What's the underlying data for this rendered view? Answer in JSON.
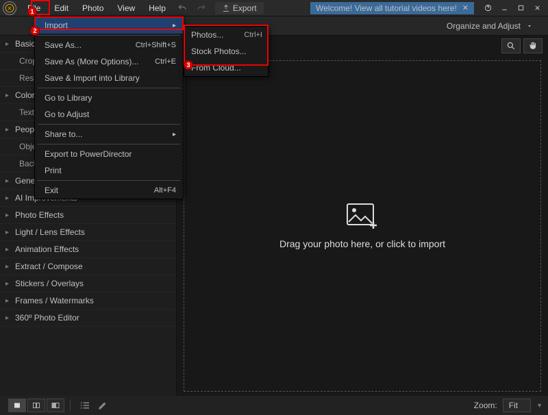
{
  "menubar": [
    "File",
    "Edit",
    "Photo",
    "View",
    "Help"
  ],
  "export_label": "Export",
  "welcome": "Welcome! View all tutorial videos here!",
  "mode": "Organize and Adjust",
  "sidebar": [
    {
      "type": "cat",
      "label": "Basic"
    },
    {
      "type": "sub",
      "label": "Crop"
    },
    {
      "type": "sub",
      "label": "Resiz"
    },
    {
      "type": "cat",
      "label": "Color"
    },
    {
      "type": "sub",
      "label": "Text"
    },
    {
      "type": "cat",
      "label": "People"
    },
    {
      "type": "sub",
      "label": "Obje"
    },
    {
      "type": "sub",
      "label": "Back"
    },
    {
      "type": "cat",
      "label": "Gene"
    },
    {
      "type": "cat",
      "label": "AI Improvements"
    },
    {
      "type": "cat",
      "label": "Photo Effects"
    },
    {
      "type": "cat",
      "label": "Light / Lens Effects"
    },
    {
      "type": "cat",
      "label": "Animation Effects"
    },
    {
      "type": "cat",
      "label": "Extract / Compose"
    },
    {
      "type": "cat",
      "label": "Stickers / Overlays"
    },
    {
      "type": "cat",
      "label": "Frames / Watermarks"
    },
    {
      "type": "cat",
      "label": "360º Photo Editor"
    }
  ],
  "viewport_text": "Drag your photo here, or click to import",
  "zoom_label": "Zoom:",
  "zoom_value": "Fit",
  "file_menu": [
    {
      "label": "Import",
      "hl": true,
      "arrow": true
    },
    {
      "sep": true
    },
    {
      "label": "Save As...",
      "dis": true,
      "shortcut": "Ctrl+Shift+S"
    },
    {
      "label": "Save As (More Options)...",
      "dis": true,
      "shortcut": "Ctrl+E"
    },
    {
      "label": "Save & Import into Library",
      "dis": true
    },
    {
      "sep": true
    },
    {
      "label": "Go to Library"
    },
    {
      "label": "Go to Adjust"
    },
    {
      "sep": true
    },
    {
      "label": "Share to...",
      "dis": true,
      "arrow": true
    },
    {
      "sep": true
    },
    {
      "label": "Export to PowerDirector",
      "dis": true
    },
    {
      "label": "Print",
      "dis": true
    },
    {
      "sep": true
    },
    {
      "label": "Exit",
      "shortcut": "Alt+F4"
    }
  ],
  "import_submenu": [
    {
      "label": "Photos...",
      "shortcut": "Ctrl+I"
    },
    {
      "label": "Stock Photos..."
    },
    {
      "label": "From Cloud..."
    }
  ],
  "annot": {
    "1": "1",
    "2": "2",
    "3": "3"
  }
}
